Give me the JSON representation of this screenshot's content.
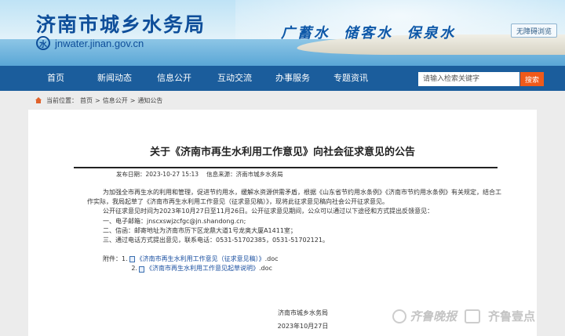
{
  "header": {
    "site_title": "济南市城乡水务局",
    "site_domain": "jnwater.jinan.gov.cn",
    "slogan": "广蓄水  储客水  保泉水",
    "accessibility_button": "无障碍浏览"
  },
  "nav": {
    "items": [
      "首页",
      "新闻动态",
      "信息公开",
      "互动交流",
      "办事服务",
      "专题资讯"
    ],
    "search_placeholder": "请输入检索关键字",
    "search_button": "搜索"
  },
  "breadcrumb": {
    "prefix": "当前位置：",
    "items": [
      "首页",
      "信息公开",
      "通知公告"
    ],
    "separator": ">"
  },
  "article": {
    "title": "关于《济南市再生水利用工作意见》向社会征求意见的公告",
    "publish_date": "发布日期：2023-10-27 15:13",
    "source": "信息来源：济南市城乡水务局",
    "paragraphs": [
      "为加强全市再生水的利用和管理，促进节约用水，缓解水资源供需矛盾，根据《山东省节约用水条例》《济南市节约用水条例》有关规定，结合工作实际，我局起草了《济南市再生水利用工作意见（征求意见稿）》，现将此征求意见稿向社会公开征求意见。",
      "公开征求意见时间为2023年10月27日至11月26日。公开征求意见期间，公众可以通过以下途径和方式提出反馈意见：",
      "一、电子邮箱：jnscxswjzcfgc@jn.shandong.cn;",
      "二、信函：邮寄地址为济南市历下区龙鼎大道1号龙奥大厦A1411室；",
      "三、通过电话方式提出意见，联系电话：0531-51702385，0531-51702121。"
    ],
    "attachments_label": "附件：",
    "attachments": [
      {
        "num": "1.",
        "name": "《济南市再生水利用工作意见（征求意见稿）》",
        "ext": ".doc"
      },
      {
        "num": "2.",
        "name": "《济南市再生水利用工作意见起草说明》",
        "ext": ".doc"
      }
    ],
    "signature_org": "济南市城乡水务局",
    "signature_date": "2023年10月27日"
  },
  "watermark": {
    "text1": "齐鲁晚报",
    "text2": "齐鲁壹点"
  }
}
